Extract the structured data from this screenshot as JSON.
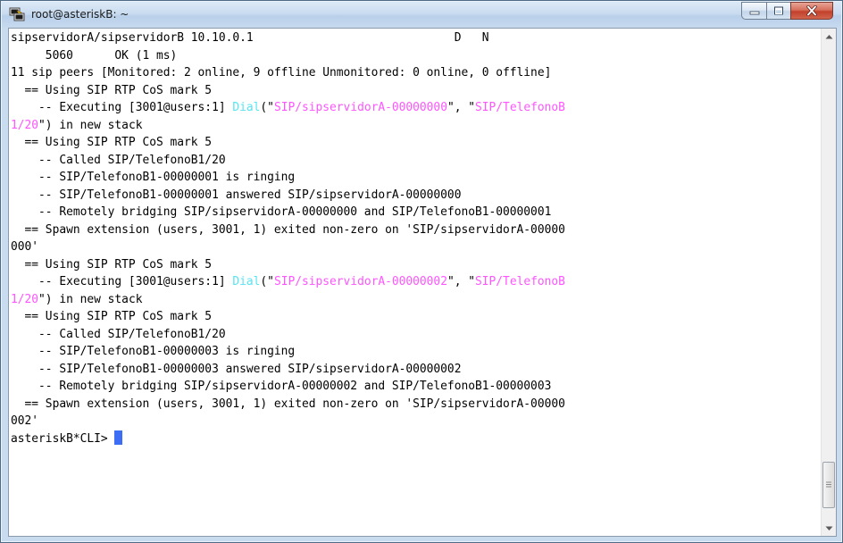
{
  "window": {
    "title": "root@asteriskB: ~",
    "icon": "putty-terminal-icon",
    "controls": {
      "minimize": "minimize-icon",
      "maximize": "maximize-icon",
      "close": "close-icon"
    }
  },
  "colors": {
    "dial_app": "#55e5f2",
    "dial_args": "#ff55ff",
    "cursor": "#3d6cf5",
    "background": "#ffffff",
    "text": "#000000"
  },
  "terminal": {
    "lines": [
      [
        {
          "t": "sipservidorA/sipservidorB 10.10.0.1                             D   N"
        }
      ],
      [
        {
          "t": "     5060      OK (1 ms)"
        }
      ],
      [
        {
          "t": "11 sip peers [Monitored: 2 online, 9 offline Unmonitored: 0 online, 0 offline]"
        }
      ],
      [
        {
          "t": "  == Using SIP RTP CoS mark 5"
        }
      ],
      [
        {
          "t": "    -- Executing [3001@users:1] "
        },
        {
          "t": "Dial",
          "c": "app"
        },
        {
          "t": "(\""
        },
        {
          "t": "SIP/sipservidorA-00000000",
          "c": "arg"
        },
        {
          "t": "\", \""
        },
        {
          "t": "SIP/TelefonoB",
          "c": "arg"
        }
      ],
      [
        {
          "t": "1/20",
          "c": "arg"
        },
        {
          "t": "\") in new stack"
        }
      ],
      [
        {
          "t": "  == Using SIP RTP CoS mark 5"
        }
      ],
      [
        {
          "t": "    -- Called SIP/TelefonoB1/20"
        }
      ],
      [
        {
          "t": "    -- SIP/TelefonoB1-00000001 is ringing"
        }
      ],
      [
        {
          "t": "    -- SIP/TelefonoB1-00000001 answered SIP/sipservidorA-00000000"
        }
      ],
      [
        {
          "t": "    -- Remotely bridging SIP/sipservidorA-00000000 and SIP/TelefonoB1-00000001"
        }
      ],
      [
        {
          "t": "  == Spawn extension (users, 3001, 1) exited non-zero on 'SIP/sipservidorA-00000"
        }
      ],
      [
        {
          "t": "000'"
        }
      ],
      [
        {
          "t": "  == Using SIP RTP CoS mark 5"
        }
      ],
      [
        {
          "t": "    -- Executing [3001@users:1] "
        },
        {
          "t": "Dial",
          "c": "app"
        },
        {
          "t": "(\""
        },
        {
          "t": "SIP/sipservidorA-00000002",
          "c": "arg"
        },
        {
          "t": "\", \""
        },
        {
          "t": "SIP/TelefonoB",
          "c": "arg"
        }
      ],
      [
        {
          "t": "1/20",
          "c": "arg"
        },
        {
          "t": "\") in new stack"
        }
      ],
      [
        {
          "t": "  == Using SIP RTP CoS mark 5"
        }
      ],
      [
        {
          "t": "    -- Called SIP/TelefonoB1/20"
        }
      ],
      [
        {
          "t": "    -- SIP/TelefonoB1-00000003 is ringing"
        }
      ],
      [
        {
          "t": "    -- SIP/TelefonoB1-00000003 answered SIP/sipservidorA-00000002"
        }
      ],
      [
        {
          "t": "    -- Remotely bridging SIP/sipservidorA-00000002 and SIP/TelefonoB1-00000003"
        }
      ],
      [
        {
          "t": "  == Spawn extension (users, 3001, 1) exited non-zero on 'SIP/sipservidorA-00000"
        }
      ],
      [
        {
          "t": "002'"
        }
      ]
    ],
    "prompt": "asteriskB*CLI> "
  },
  "scrollbar": {
    "up": "scroll-up-arrow-icon",
    "down": "scroll-down-arrow-icon",
    "position": 0.97
  }
}
